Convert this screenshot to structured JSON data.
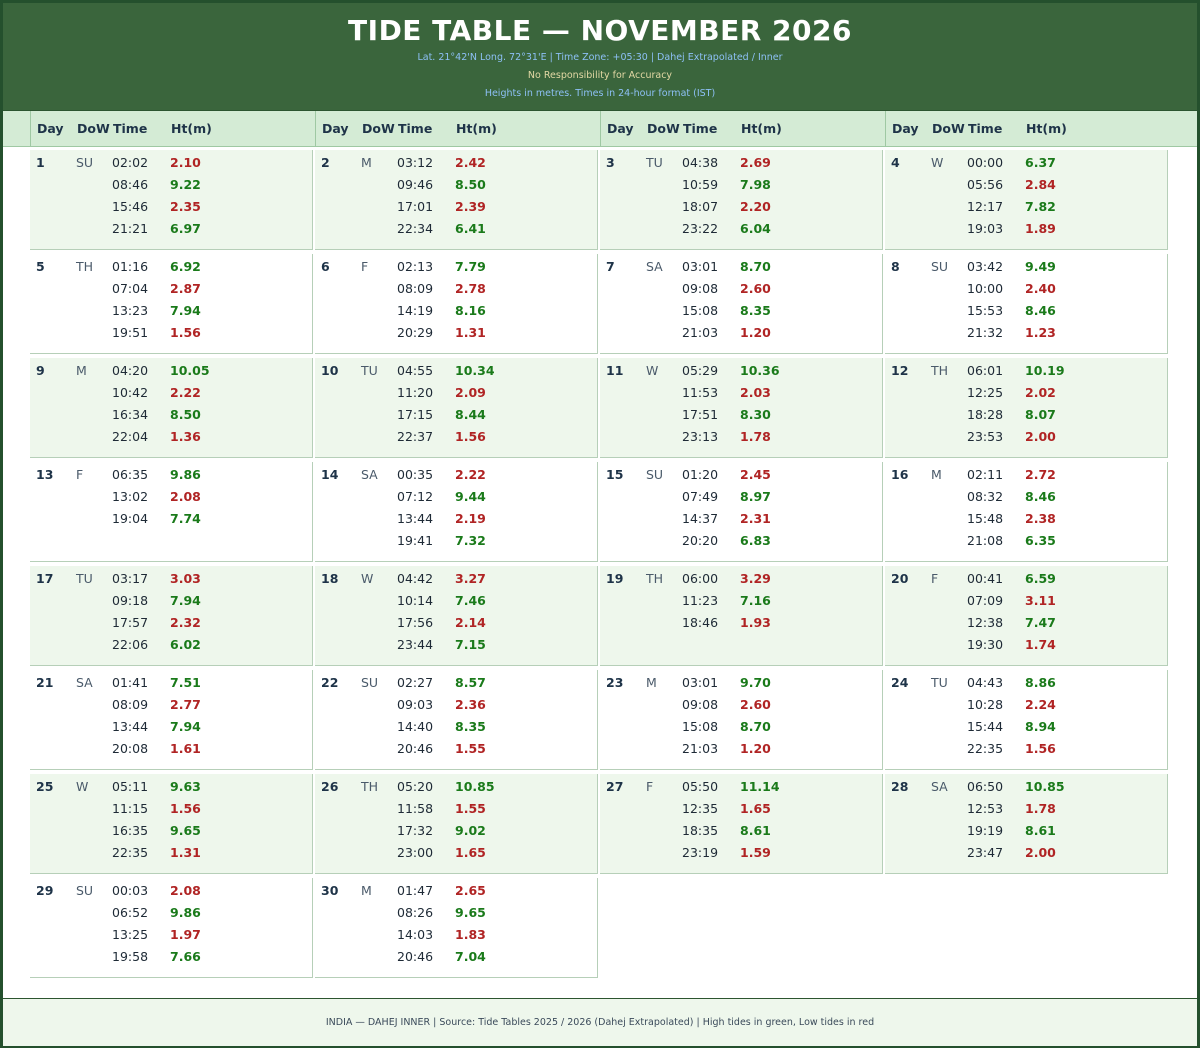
{
  "header": {
    "title": "TIDE TABLE — NOVEMBER 2026",
    "info_line": "Lat. 21°42'N  Long. 72°31'E   |   Time Zone: +05:30   |   Dahej Extrapolated / Inner",
    "disclaimer": "No Responsibility for Accuracy",
    "units_note": "Heights in metres.  Times in 24-hour format (IST)"
  },
  "columns": {
    "day": "Day",
    "dow": "DoW",
    "time": "Time",
    "height": "Ht(m)"
  },
  "colors": {
    "header_bg": "#3a653c",
    "high_tide": "#1a7a1a",
    "low_tide": "#b02424",
    "shade": "#eef7ec"
  },
  "days": [
    {
      "day": "1",
      "dow": "SU",
      "tides": [
        {
          "time": "02:02",
          "ht": "2.10",
          "type": "low"
        },
        {
          "time": "08:46",
          "ht": "9.22",
          "type": "high"
        },
        {
          "time": "15:46",
          "ht": "2.35",
          "type": "low"
        },
        {
          "time": "21:21",
          "ht": "6.97",
          "type": "high"
        }
      ]
    },
    {
      "day": "2",
      "dow": "M",
      "tides": [
        {
          "time": "03:12",
          "ht": "2.42",
          "type": "low"
        },
        {
          "time": "09:46",
          "ht": "8.50",
          "type": "high"
        },
        {
          "time": "17:01",
          "ht": "2.39",
          "type": "low"
        },
        {
          "time": "22:34",
          "ht": "6.41",
          "type": "high"
        }
      ]
    },
    {
      "day": "3",
      "dow": "TU",
      "tides": [
        {
          "time": "04:38",
          "ht": "2.69",
          "type": "low"
        },
        {
          "time": "10:59",
          "ht": "7.98",
          "type": "high"
        },
        {
          "time": "18:07",
          "ht": "2.20",
          "type": "low"
        },
        {
          "time": "23:22",
          "ht": "6.04",
          "type": "high"
        }
      ]
    },
    {
      "day": "4",
      "dow": "W",
      "tides": [
        {
          "time": "00:00",
          "ht": "6.37",
          "type": "high"
        },
        {
          "time": "05:56",
          "ht": "2.84",
          "type": "low"
        },
        {
          "time": "12:17",
          "ht": "7.82",
          "type": "high"
        },
        {
          "time": "19:03",
          "ht": "1.89",
          "type": "low"
        }
      ]
    },
    {
      "day": "5",
      "dow": "TH",
      "tides": [
        {
          "time": "01:16",
          "ht": "6.92",
          "type": "high"
        },
        {
          "time": "07:04",
          "ht": "2.87",
          "type": "low"
        },
        {
          "time": "13:23",
          "ht": "7.94",
          "type": "high"
        },
        {
          "time": "19:51",
          "ht": "1.56",
          "type": "low"
        }
      ]
    },
    {
      "day": "6",
      "dow": "F",
      "tides": [
        {
          "time": "02:13",
          "ht": "7.79",
          "type": "high"
        },
        {
          "time": "08:09",
          "ht": "2.78",
          "type": "low"
        },
        {
          "time": "14:19",
          "ht": "8.16",
          "type": "high"
        },
        {
          "time": "20:29",
          "ht": "1.31",
          "type": "low"
        }
      ]
    },
    {
      "day": "7",
      "dow": "SA",
      "tides": [
        {
          "time": "03:01",
          "ht": "8.70",
          "type": "high"
        },
        {
          "time": "09:08",
          "ht": "2.60",
          "type": "low"
        },
        {
          "time": "15:08",
          "ht": "8.35",
          "type": "high"
        },
        {
          "time": "21:03",
          "ht": "1.20",
          "type": "low"
        }
      ]
    },
    {
      "day": "8",
      "dow": "SU",
      "tides": [
        {
          "time": "03:42",
          "ht": "9.49",
          "type": "high"
        },
        {
          "time": "10:00",
          "ht": "2.40",
          "type": "low"
        },
        {
          "time": "15:53",
          "ht": "8.46",
          "type": "high"
        },
        {
          "time": "21:32",
          "ht": "1.23",
          "type": "low"
        }
      ]
    },
    {
      "day": "9",
      "dow": "M",
      "tides": [
        {
          "time": "04:20",
          "ht": "10.05",
          "type": "high"
        },
        {
          "time": "10:42",
          "ht": "2.22",
          "type": "low"
        },
        {
          "time": "16:34",
          "ht": "8.50",
          "type": "high"
        },
        {
          "time": "22:04",
          "ht": "1.36",
          "type": "low"
        }
      ]
    },
    {
      "day": "10",
      "dow": "TU",
      "tides": [
        {
          "time": "04:55",
          "ht": "10.34",
          "type": "high"
        },
        {
          "time": "11:20",
          "ht": "2.09",
          "type": "low"
        },
        {
          "time": "17:15",
          "ht": "8.44",
          "type": "high"
        },
        {
          "time": "22:37",
          "ht": "1.56",
          "type": "low"
        }
      ]
    },
    {
      "day": "11",
      "dow": "W",
      "tides": [
        {
          "time": "05:29",
          "ht": "10.36",
          "type": "high"
        },
        {
          "time": "11:53",
          "ht": "2.03",
          "type": "low"
        },
        {
          "time": "17:51",
          "ht": "8.30",
          "type": "high"
        },
        {
          "time": "23:13",
          "ht": "1.78",
          "type": "low"
        }
      ]
    },
    {
      "day": "12",
      "dow": "TH",
      "tides": [
        {
          "time": "06:01",
          "ht": "10.19",
          "type": "high"
        },
        {
          "time": "12:25",
          "ht": "2.02",
          "type": "low"
        },
        {
          "time": "18:28",
          "ht": "8.07",
          "type": "high"
        },
        {
          "time": "23:53",
          "ht": "2.00",
          "type": "low"
        }
      ]
    },
    {
      "day": "13",
      "dow": "F",
      "tides": [
        {
          "time": "06:35",
          "ht": "9.86",
          "type": "high"
        },
        {
          "time": "13:02",
          "ht": "2.08",
          "type": "low"
        },
        {
          "time": "19:04",
          "ht": "7.74",
          "type": "high"
        }
      ]
    },
    {
      "day": "14",
      "dow": "SA",
      "tides": [
        {
          "time": "00:35",
          "ht": "2.22",
          "type": "low"
        },
        {
          "time": "07:12",
          "ht": "9.44",
          "type": "high"
        },
        {
          "time": "13:44",
          "ht": "2.19",
          "type": "low"
        },
        {
          "time": "19:41",
          "ht": "7.32",
          "type": "high"
        }
      ]
    },
    {
      "day": "15",
      "dow": "SU",
      "tides": [
        {
          "time": "01:20",
          "ht": "2.45",
          "type": "low"
        },
        {
          "time": "07:49",
          "ht": "8.97",
          "type": "high"
        },
        {
          "time": "14:37",
          "ht": "2.31",
          "type": "low"
        },
        {
          "time": "20:20",
          "ht": "6.83",
          "type": "high"
        }
      ]
    },
    {
      "day": "16",
      "dow": "M",
      "tides": [
        {
          "time": "02:11",
          "ht": "2.72",
          "type": "low"
        },
        {
          "time": "08:32",
          "ht": "8.46",
          "type": "high"
        },
        {
          "time": "15:48",
          "ht": "2.38",
          "type": "low"
        },
        {
          "time": "21:08",
          "ht": "6.35",
          "type": "high"
        }
      ]
    },
    {
      "day": "17",
      "dow": "TU",
      "tides": [
        {
          "time": "03:17",
          "ht": "3.03",
          "type": "low"
        },
        {
          "time": "09:18",
          "ht": "7.94",
          "type": "high"
        },
        {
          "time": "17:57",
          "ht": "2.32",
          "type": "low"
        },
        {
          "time": "22:06",
          "ht": "6.02",
          "type": "high"
        }
      ]
    },
    {
      "day": "18",
      "dow": "W",
      "tides": [
        {
          "time": "04:42",
          "ht": "3.27",
          "type": "low"
        },
        {
          "time": "10:14",
          "ht": "7.46",
          "type": "high"
        },
        {
          "time": "17:56",
          "ht": "2.14",
          "type": "low"
        },
        {
          "time": "23:44",
          "ht": "7.15",
          "type": "high"
        }
      ]
    },
    {
      "day": "19",
      "dow": "TH",
      "tides": [
        {
          "time": "06:00",
          "ht": "3.29",
          "type": "low"
        },
        {
          "time": "11:23",
          "ht": "7.16",
          "type": "high"
        },
        {
          "time": "18:46",
          "ht": "1.93",
          "type": "low"
        }
      ]
    },
    {
      "day": "20",
      "dow": "F",
      "tides": [
        {
          "time": "00:41",
          "ht": "6.59",
          "type": "high"
        },
        {
          "time": "07:09",
          "ht": "3.11",
          "type": "low"
        },
        {
          "time": "12:38",
          "ht": "7.47",
          "type": "high"
        },
        {
          "time": "19:30",
          "ht": "1.74",
          "type": "low"
        }
      ]
    },
    {
      "day": "21",
      "dow": "SA",
      "tides": [
        {
          "time": "01:41",
          "ht": "7.51",
          "type": "high"
        },
        {
          "time": "08:09",
          "ht": "2.77",
          "type": "low"
        },
        {
          "time": "13:44",
          "ht": "7.94",
          "type": "high"
        },
        {
          "time": "20:08",
          "ht": "1.61",
          "type": "low"
        }
      ]
    },
    {
      "day": "22",
      "dow": "SU",
      "tides": [
        {
          "time": "02:27",
          "ht": "8.57",
          "type": "high"
        },
        {
          "time": "09:03",
          "ht": "2.36",
          "type": "low"
        },
        {
          "time": "14:40",
          "ht": "8.35",
          "type": "high"
        },
        {
          "time": "20:46",
          "ht": "1.55",
          "type": "low"
        }
      ]
    },
    {
      "day": "23",
      "dow": "M",
      "tides": [
        {
          "time": "03:01",
          "ht": "9.70",
          "type": "high"
        },
        {
          "time": "09:08",
          "ht": "2.60",
          "type": "low"
        },
        {
          "time": "15:08",
          "ht": "8.70",
          "type": "high"
        },
        {
          "time": "21:03",
          "ht": "1.20",
          "type": "low"
        }
      ]
    },
    {
      "day": "24",
      "dow": "TU",
      "tides": [
        {
          "time": "04:43",
          "ht": "8.86",
          "type": "high"
        },
        {
          "time": "10:28",
          "ht": "2.24",
          "type": "low"
        },
        {
          "time": "15:44",
          "ht": "8.94",
          "type": "high"
        },
        {
          "time": "22:35",
          "ht": "1.56",
          "type": "low"
        }
      ]
    },
    {
      "day": "25",
      "dow": "W",
      "tides": [
        {
          "time": "05:11",
          "ht": "9.63",
          "type": "high"
        },
        {
          "time": "11:15",
          "ht": "1.56",
          "type": "low"
        },
        {
          "time": "16:35",
          "ht": "9.65",
          "type": "high"
        },
        {
          "time": "22:35",
          "ht": "1.31",
          "type": "low"
        }
      ]
    },
    {
      "day": "26",
      "dow": "TH",
      "tides": [
        {
          "time": "05:20",
          "ht": "10.85",
          "type": "high"
        },
        {
          "time": "11:58",
          "ht": "1.55",
          "type": "low"
        },
        {
          "time": "17:32",
          "ht": "9.02",
          "type": "high"
        },
        {
          "time": "23:00",
          "ht": "1.65",
          "type": "low"
        }
      ]
    },
    {
      "day": "27",
      "dow": "F",
      "tides": [
        {
          "time": "05:50",
          "ht": "11.14",
          "type": "high"
        },
        {
          "time": "12:35",
          "ht": "1.65",
          "type": "low"
        },
        {
          "time": "18:35",
          "ht": "8.61",
          "type": "high"
        },
        {
          "time": "23:19",
          "ht": "1.59",
          "type": "low"
        }
      ]
    },
    {
      "day": "28",
      "dow": "SA",
      "tides": [
        {
          "time": "06:50",
          "ht": "10.85",
          "type": "high"
        },
        {
          "time": "12:53",
          "ht": "1.78",
          "type": "low"
        },
        {
          "time": "19:19",
          "ht": "8.61",
          "type": "high"
        },
        {
          "time": "23:47",
          "ht": "2.00",
          "type": "low"
        }
      ]
    },
    {
      "day": "29",
      "dow": "SU",
      "tides": [
        {
          "time": "00:03",
          "ht": "2.08",
          "type": "low"
        },
        {
          "time": "06:52",
          "ht": "9.86",
          "type": "high"
        },
        {
          "time": "13:25",
          "ht": "1.97",
          "type": "low"
        },
        {
          "time": "19:58",
          "ht": "7.66",
          "type": "high"
        }
      ]
    },
    {
      "day": "30",
      "dow": "M",
      "tides": [
        {
          "time": "01:47",
          "ht": "2.65",
          "type": "low"
        },
        {
          "time": "08:26",
          "ht": "9.65",
          "type": "high"
        },
        {
          "time": "14:03",
          "ht": "1.83",
          "type": "low"
        },
        {
          "time": "20:46",
          "ht": "7.04",
          "type": "high"
        }
      ]
    }
  ],
  "footer": {
    "text": "INDIA — DAHEJ INNER   |   Source: Tide Tables 2025 / 2026 (Dahej Extrapolated)   |   High tides in green, Low tides in red"
  }
}
